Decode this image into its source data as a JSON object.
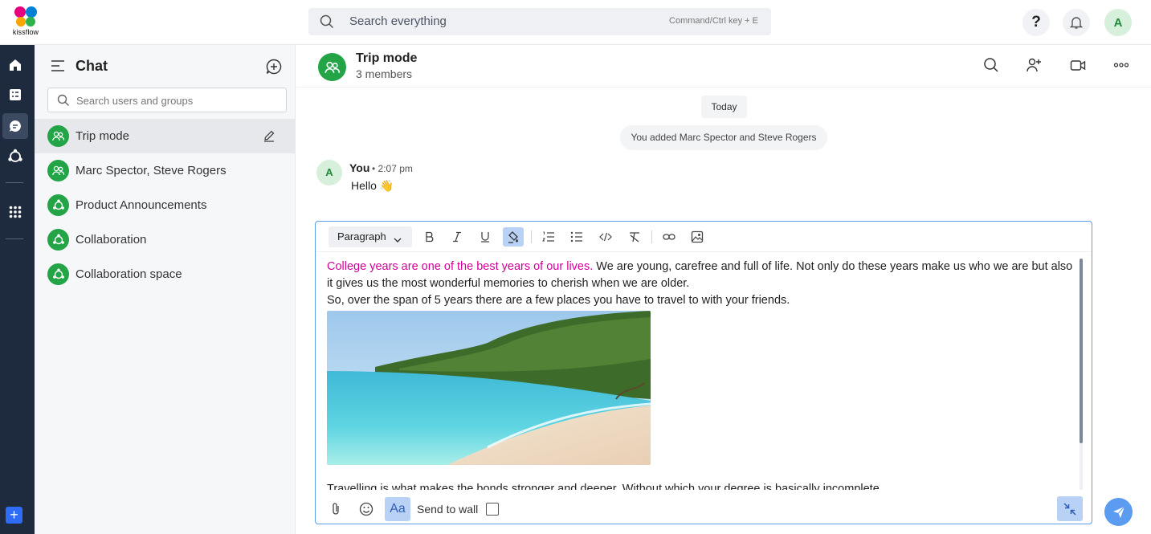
{
  "app": {
    "logo_text": "kissflow",
    "search_placeholder": "Search everything",
    "search_hint": "Command/Ctrl key + E",
    "help_label": "?",
    "user_initial": "A"
  },
  "nav": {
    "items": [
      "home-icon",
      "tasks-icon",
      "chat-icon",
      "community-icon",
      "apps-icon"
    ],
    "add_label": "+"
  },
  "chat_list": {
    "title": "Chat",
    "search_placeholder": "Search users and groups",
    "items": [
      {
        "name": "Trip mode",
        "type": "group",
        "active": true
      },
      {
        "name": "Marc Spector, Steve Rogers",
        "type": "group",
        "active": false
      },
      {
        "name": "Product Announcements",
        "type": "channel",
        "active": false
      },
      {
        "name": "Collaboration",
        "type": "channel",
        "active": false
      },
      {
        "name": "Collaboration space",
        "type": "channel",
        "active": false
      }
    ]
  },
  "conversation": {
    "title": "Trip mode",
    "subtitle": "3 members",
    "date_divider": "Today",
    "system_message": "You added Marc Spector and Steve Rogers",
    "messages": [
      {
        "initial": "A",
        "author": "You",
        "time": "• 2:07 pm",
        "text": "Hello 👋"
      }
    ]
  },
  "editor": {
    "paragraph_label": "Paragraph",
    "highlighted_text": "College years are one of the best years of our lives.",
    "text_rest": " We are young, carefree and full of life. Not only do these years make us who we are but also it gives us the most wonderful memories to cherish when we are older.",
    "line2": "So, over the span of 5 years there are a few places you have to travel to with your friends.",
    "line3": "Travelling is what makes the bonds stronger and deeper. Without which your degree is basically incomplete.",
    "font_toggle_label": "Aa",
    "send_to_wall_label": "Send to wall",
    "send_to_wall_checked": false
  },
  "colors": {
    "accent": "#5b9bf0",
    "group_green": "#22a447",
    "nav_bg": "#1e2a3d",
    "highlight_pink": "#d3009a"
  }
}
